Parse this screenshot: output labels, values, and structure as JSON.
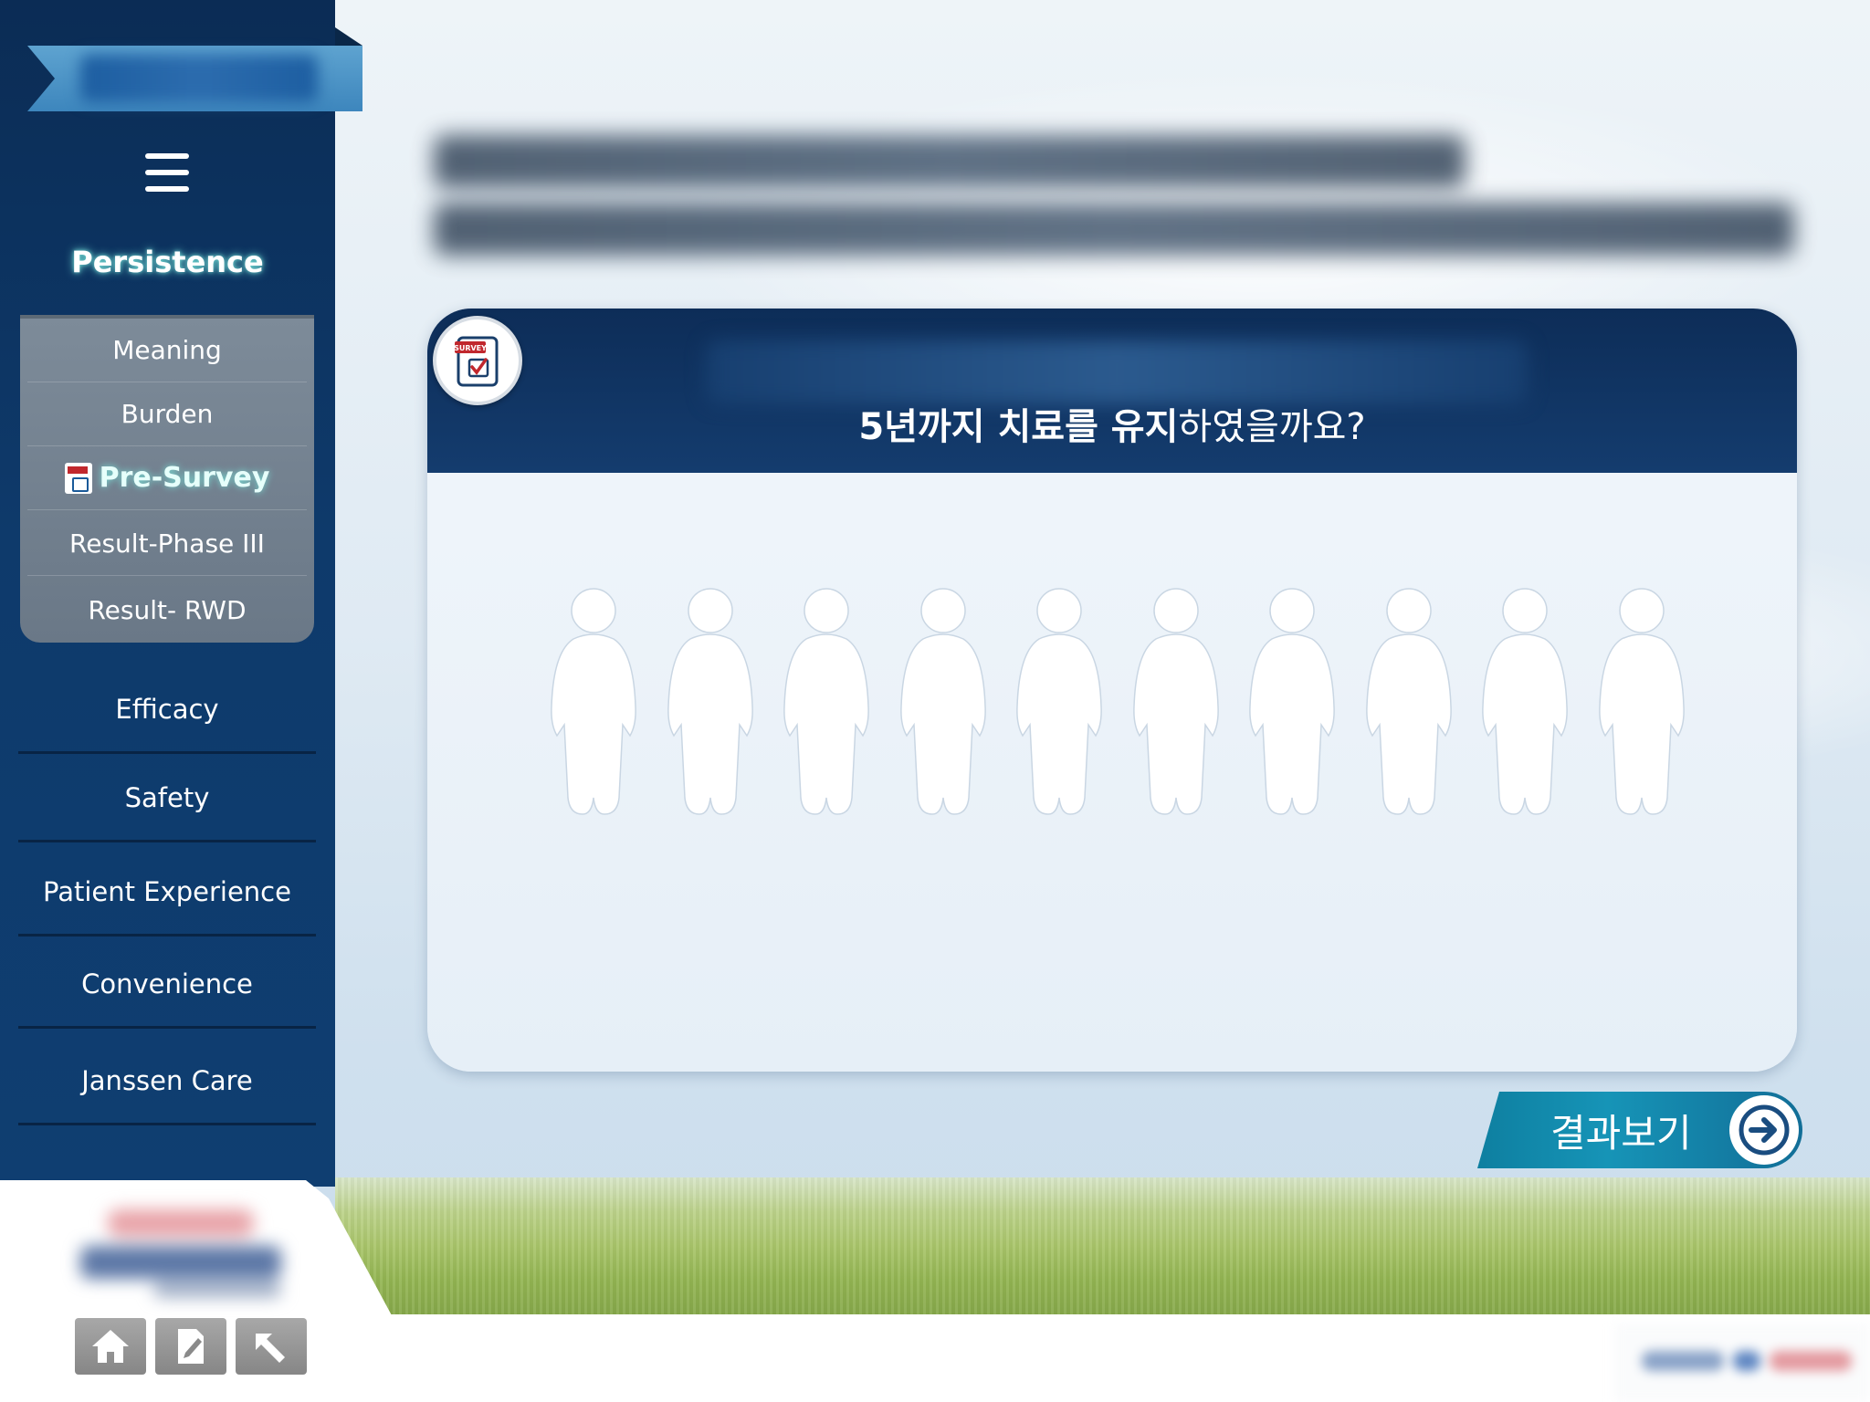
{
  "sidebar": {
    "section_title": "Persistence",
    "submenu": [
      {
        "label": "Meaning",
        "active": false
      },
      {
        "label": "Burden",
        "active": false
      },
      {
        "label": "Pre-Survey",
        "active": true
      },
      {
        "label": "Result-Phase III",
        "active": false
      },
      {
        "label": "Result- RWD",
        "active": false
      }
    ],
    "nav": [
      {
        "label": "Efficacy"
      },
      {
        "label": "Safety"
      },
      {
        "label": "Patient Experience"
      },
      {
        "label": "Convenience"
      },
      {
        "label": "Janssen Care"
      }
    ],
    "footer_buttons": [
      {
        "icon": "home-icon"
      },
      {
        "icon": "note-edit-icon"
      },
      {
        "icon": "back-arrow-icon"
      }
    ]
  },
  "survey": {
    "badge_text": "SURVEY",
    "question_strong": "5년까지 치료를 유지",
    "question_rest": "하였을까요?",
    "people_count": 10
  },
  "result_button": {
    "label": "결과보기"
  },
  "colors": {
    "navy": "#0d2d58",
    "teal_button": "#1694b7",
    "submenu_gray": "#7d8b99",
    "glow": "#78e6dc"
  }
}
